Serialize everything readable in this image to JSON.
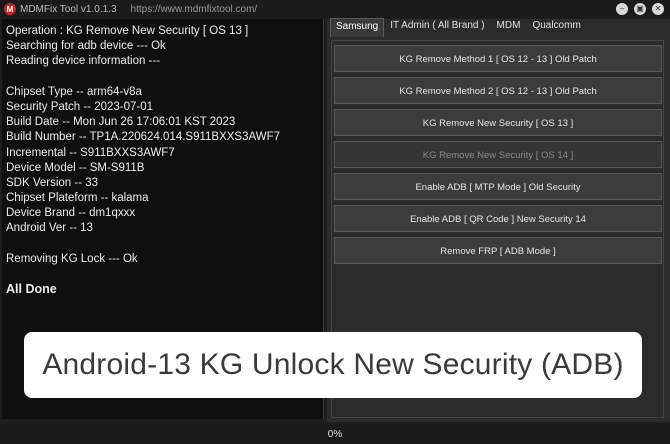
{
  "window": {
    "app_icon": "M",
    "title": "MDMFix Tool v1.0.1.3",
    "url": "https://www.mdmfixtool.com/",
    "controls": [
      "‒",
      "▣",
      "✕"
    ]
  },
  "log": {
    "lines": [
      {
        "text": "Operation : KG Remove New Security [ OS 13 ]",
        "bold": false
      },
      {
        "text": "Searching for adb device --- Ok",
        "bold": false
      },
      {
        "text": "Reading device information ---",
        "bold": false
      },
      {
        "text": "",
        "bold": false
      },
      {
        "text": "Chipset Type -- arm64-v8a",
        "bold": false
      },
      {
        "text": "Security Patch -- 2023-07-01",
        "bold": false
      },
      {
        "text": "Build Date -- Mon Jun 26 17:06:01 KST 2023",
        "bold": false
      },
      {
        "text": "Build Number -- TP1A.220624.014.S911BXXS3AWF7",
        "bold": false
      },
      {
        "text": "Incremental -- S911BXXS3AWF7",
        "bold": false
      },
      {
        "text": "Device Model -- SM-S911B",
        "bold": false
      },
      {
        "text": "SDK Version -- 33",
        "bold": false
      },
      {
        "text": "Chipset Plateform -- kalama",
        "bold": false
      },
      {
        "text": "Device Brand -- dm1qxxx",
        "bold": false
      },
      {
        "text": "Android Ver -- 13",
        "bold": false
      },
      {
        "text": "",
        "bold": false
      },
      {
        "text": "Removing KG Lock --- Ok",
        "bold": false
      },
      {
        "text": "",
        "bold": false
      },
      {
        "text": "All Done",
        "bold": true
      }
    ]
  },
  "tabs": [
    {
      "label": "Samsung",
      "active": true
    },
    {
      "label": "IT Admin ( All Brand )",
      "active": false
    },
    {
      "label": "MDM",
      "active": false
    },
    {
      "label": "Qualcomm",
      "active": false
    }
  ],
  "buttons": [
    {
      "label": "KG Remove Method 1 [ OS 12 - 13 ] Old Patch",
      "enabled": true
    },
    {
      "label": "KG Remove Method 2 [ OS 12 - 13 ] Old Patch",
      "enabled": true
    },
    {
      "label": "KG Remove New Security [ OS 13 ]",
      "enabled": true
    },
    {
      "label": "KG Remove New Security [ OS 14 ]",
      "enabled": false
    },
    {
      "label": "Enable ADB [ MTP Mode ] Old Security",
      "enabled": true
    },
    {
      "label": "Enable ADB [ QR Code ] New Security 14",
      "enabled": true
    },
    {
      "label": "Remove FRP [ ADB Mode ]",
      "enabled": true
    }
  ],
  "status": {
    "progress_text": "0%",
    "progress": 0
  },
  "caption": "Android-13 KG Unlock New Security (ADB)"
}
